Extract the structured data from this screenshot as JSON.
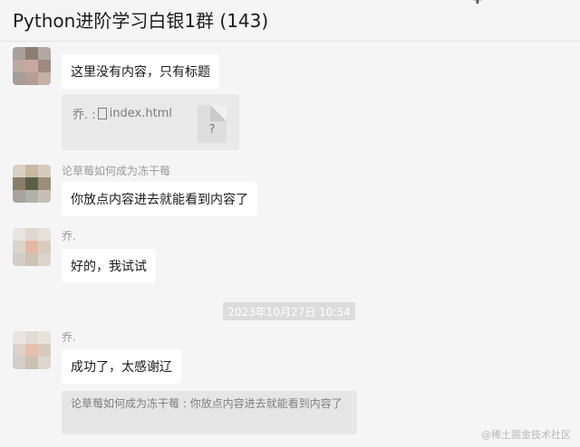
{
  "window": {
    "title": "Python进阶学习白银1群 (143)",
    "icons": [
      "add-icon",
      "more-icon"
    ]
  },
  "messages": [
    {
      "type": "text",
      "content": "这里没有内容，只有标题"
    },
    {
      "type": "file",
      "sender": "乔.",
      "file_name": "index.html",
      "thumb_glyph": "?"
    },
    {
      "type": "text",
      "sender": "论草莓如何成为冻干莓",
      "content": "你放点内容进去就能看到内容了"
    },
    {
      "type": "text",
      "sender": "乔.",
      "content": "好的，我试试"
    },
    {
      "type": "timestamp",
      "content": "2023年10月27日 10:54"
    },
    {
      "type": "text",
      "sender": "乔.",
      "content": "成功了，太感谢辽"
    },
    {
      "type": "quote",
      "content": "论草莓如何成为冻干莓 : 你放点内容进去就能看到内容了"
    }
  ],
  "file_card": {
    "prefix": "乔. :"
  },
  "watermark": "@稀土掘金技术社区",
  "colors": {
    "background": "#f5f5f5",
    "bubble": "#ffffff",
    "quote_bg": "#e6e6e6",
    "timestamp_bg": "#dcdcdc"
  }
}
